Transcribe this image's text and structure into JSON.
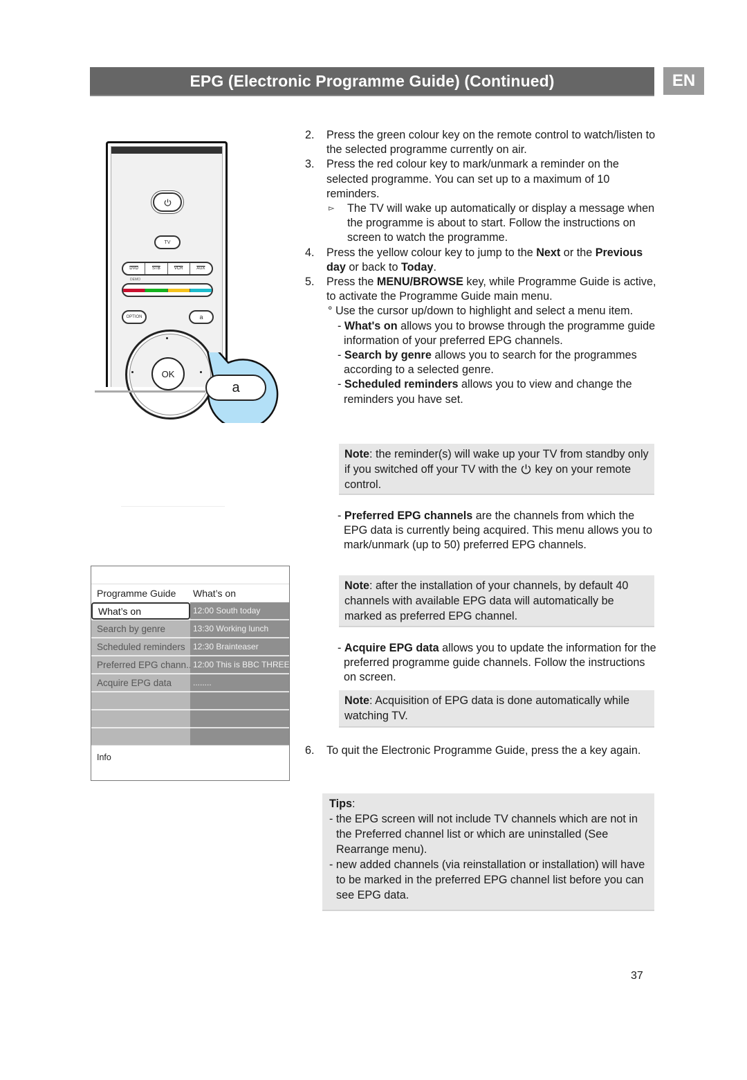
{
  "header": {
    "title": "EPG (Electronic Programme Guide) (Continued)",
    "language_badge": "EN"
  },
  "remote": {
    "power_icon": "power-icon",
    "tv_label": "TV",
    "source_buttons": [
      "DVD",
      "STB",
      "VCR",
      "AUX"
    ],
    "demo_label": "DEMO",
    "color_keys": [
      {
        "name": "red",
        "color": "#c8102e"
      },
      {
        "name": "green",
        "color": "#14b21e"
      },
      {
        "name": "yellow",
        "color": "#f5c21b"
      },
      {
        "name": "cyan",
        "color": "#1bbccc"
      }
    ],
    "option_label": "OPTION",
    "a_label": "a",
    "ok_label": "OK",
    "callout_label": "a",
    "callout_color": "#b3e0f7"
  },
  "epg_menu": {
    "col1_header": "Programme Guide",
    "col2_header": "What’s on",
    "rows": [
      {
        "label": "What’s on",
        "programme": "12:00 South today",
        "selected": true
      },
      {
        "label": "Search by genre",
        "programme": "13:30 Working lunch"
      },
      {
        "label": "Scheduled reminders",
        "programme": "12:30 Brainteaser"
      },
      {
        "label": "Preferred EPG chann..",
        "programme": "12:00 This is BBC THREE"
      },
      {
        "label": "Acquire EPG data",
        "programme": "........"
      },
      {
        "label": "",
        "programme": ""
      },
      {
        "label": "",
        "programme": ""
      },
      {
        "label": "",
        "programme": ""
      }
    ],
    "info_label": "Info"
  },
  "steps": {
    "s2": {
      "num": "2.",
      "text": "Press the green colour key on the remote control to watch/listen to the selected programme currently on air."
    },
    "s3": {
      "num": "3.",
      "text": "Press the red colour key to mark/unmark a reminder on the selected programme.  You can set up to a maximum of 10 reminders."
    },
    "s3_sub": {
      "bullet": "▻",
      "text": "The TV will wake up automatically or display a message when the programme is about to start. Follow the instructions on screen to watch the programme."
    },
    "s4": {
      "num": "4.",
      "pre": "Press the yellow colour key to jump to the ",
      "b1": "Next",
      "mid": " or the ",
      "b2": "Previous day",
      "mid2": " or back to ",
      "b3": "Today",
      "post": "."
    },
    "s5": {
      "num": "5.",
      "pre": "Press the ",
      "b1": "MENU/BROWSE",
      "post": " key, while Programme Guide is active, to activate the Programme Guide main menu."
    },
    "s5_cursor": {
      "bullet": "°",
      "text": " Use the cursor up/down to highlight and select a menu item."
    },
    "s5_items": [
      {
        "bold": "What's on",
        "text": " allows you to browse through the programme guide information of your preferred EPG channels."
      },
      {
        "bold": "Search by genre",
        "text": " allows you to search for the programmes according to a selected genre."
      },
      {
        "bold": "Scheduled reminders",
        "text": " allows you to view and change the reminders you have set."
      }
    ],
    "note1": {
      "label": "Note",
      "text_a": ": the reminder(s) will wake up your TV from standby only if you switched off your TV with the ",
      "text_b": " key on your remote control."
    },
    "preferred": {
      "bold": "Preferred EPG channels",
      "text": " are the channels from which the EPG data is currently being  acquired. This menu allows you to mark/unmark (up to 50) preferred EPG channels."
    },
    "note2": {
      "label": "Note",
      "text": ": after the installation of your channels, by default 40 channels with available EPG data will automatically be marked as preferred EPG channel."
    },
    "acquire": {
      "bold": "Acquire EPG data",
      "text": " allows you to update the information for the preferred programme guide channels. Follow the instructions on screen."
    },
    "note3": {
      "label": "Note",
      "text": ":  Acquisition of EPG data is done automatically while watching TV."
    },
    "s6": {
      "num": "6.",
      "text": "To quit the Electronic Programme Guide, press the a key again."
    }
  },
  "tips": {
    "label": "Tips",
    "items": [
      "- the EPG screen will not include TV channels which are not in the Preferred channel list or which are uninstalled (See Rearrange menu).",
      "- new added channels (via reinstallation or installation) will have to be marked in the preferred EPG channel list before you can see EPG data."
    ]
  },
  "page_number": "37"
}
